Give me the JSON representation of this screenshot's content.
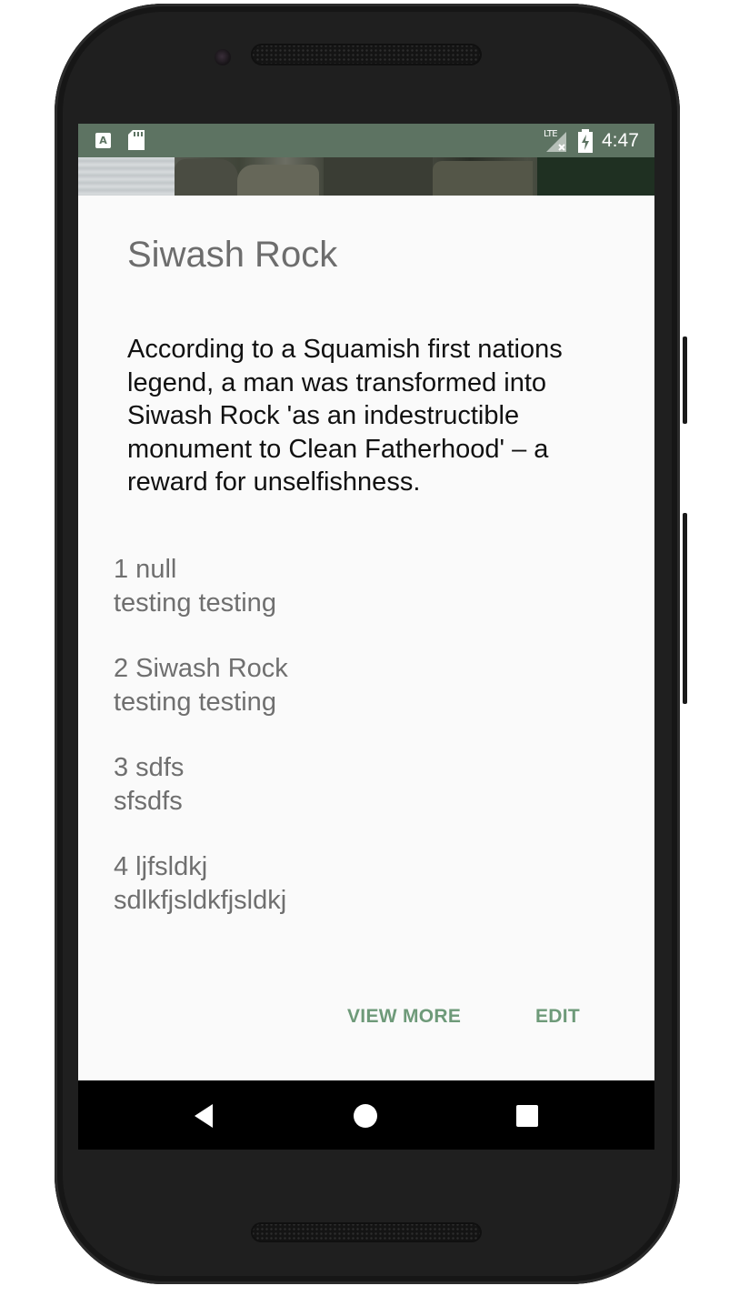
{
  "status_bar": {
    "keyboard_indicator": "A",
    "network": "LTE",
    "time": "4:47",
    "icons": [
      "a-keyboard-icon",
      "sd-card-icon",
      "lte-signal-icon",
      "battery-charging-icon"
    ]
  },
  "detail": {
    "title": "Siwash Rock",
    "description": "According to a Squamish first nations legend, a man was transformed into Siwash Rock 'as an indestructible monument to Clean Fatherhood' – a reward for unselfishness."
  },
  "entries": [
    {
      "heading": "1 null",
      "body": "testing testing"
    },
    {
      "heading": "2 Siwash Rock",
      "body": "testing testing"
    },
    {
      "heading": "3 sdfs",
      "body": "sfsdfs"
    },
    {
      "heading": "4 ljfsldkj",
      "body": "sdlkfjsldkfjsldkj"
    }
  ],
  "actions": {
    "view_more_label": "VIEW MORE",
    "edit_label": "EDIT"
  },
  "nav_bar": {
    "buttons": [
      "back-icon",
      "home-icon",
      "recents-icon"
    ]
  },
  "colors": {
    "status_bar": "#5d7362",
    "accent": "#6e9a79",
    "screen_background": "#fafafa",
    "title_text": "#6d6d6d",
    "body_text": "#111111",
    "entry_text": "#6f6f6f",
    "nav_bar": "#000000"
  }
}
